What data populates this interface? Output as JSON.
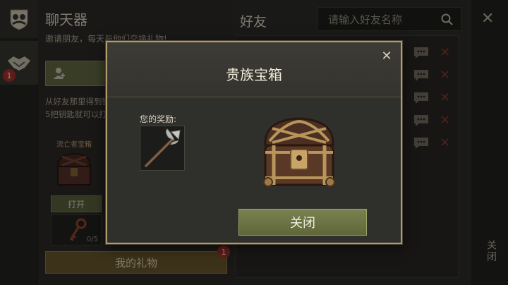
{
  "chat": {
    "title": "聊天器",
    "subtitle": "邀请朋友，每天与他们交换礼物!",
    "description": "从好友那里得到钥匙，收集\n5把钥匙就可以打开宝箱",
    "chest_label": "流亡者宝箱",
    "open_label": "打开",
    "key_count": "0/5",
    "gift_label": "我的礼物",
    "gift_badge": "1",
    "tab_badge": "1"
  },
  "friends": {
    "title": "好友",
    "search_placeholder": "请输入好友名称"
  },
  "right_rail": {
    "close_text": "关闭"
  },
  "modal": {
    "title": "贵族宝箱",
    "reward_label": "您的奖励:",
    "close_label": "关闭"
  },
  "colors": {
    "accent_gold": "#b19c6e",
    "button_green": "#6a7045",
    "badge_red": "#b0332c"
  }
}
